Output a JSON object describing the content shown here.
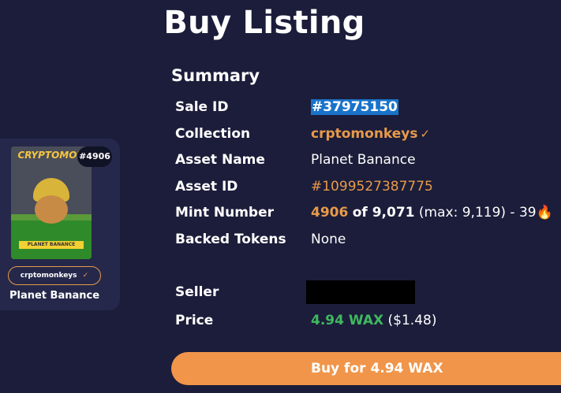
{
  "page": {
    "title": "Buy Listing"
  },
  "card": {
    "logo_text": "CRYPTOMON",
    "banner_text": "PLANET BANANCE",
    "mint_badge": "#4906",
    "collection": "crptomonkeys",
    "name": "Planet Banance"
  },
  "summary": {
    "title": "Summary",
    "rows": [
      {
        "label": "Sale ID",
        "value": "#37975150"
      },
      {
        "label": "Collection",
        "value": "crptomonkeys"
      },
      {
        "label": "Asset Name",
        "value": "Planet Banance"
      },
      {
        "label": "Asset ID",
        "value": "#1099527387775"
      },
      {
        "label": "Mint Number",
        "mint": "4906",
        "of_text": "of 9,071",
        "rest": "(max: 9,119) - 39"
      },
      {
        "label": "Backed Tokens",
        "value": "None"
      },
      {
        "label": "Seller"
      },
      {
        "label": "Price",
        "wax": "4.94 WAX",
        "usd": "($1.48)"
      }
    ]
  },
  "buy_button": {
    "label": "Buy for 4.94 WAX"
  },
  "colors": {
    "background": "#1b1d3a",
    "accent": "#e89a4a",
    "price": "#3fb85f",
    "button": "#f0954a"
  },
  "icons": {
    "verified": "verified-check-icon",
    "fire": "fire-icon"
  }
}
